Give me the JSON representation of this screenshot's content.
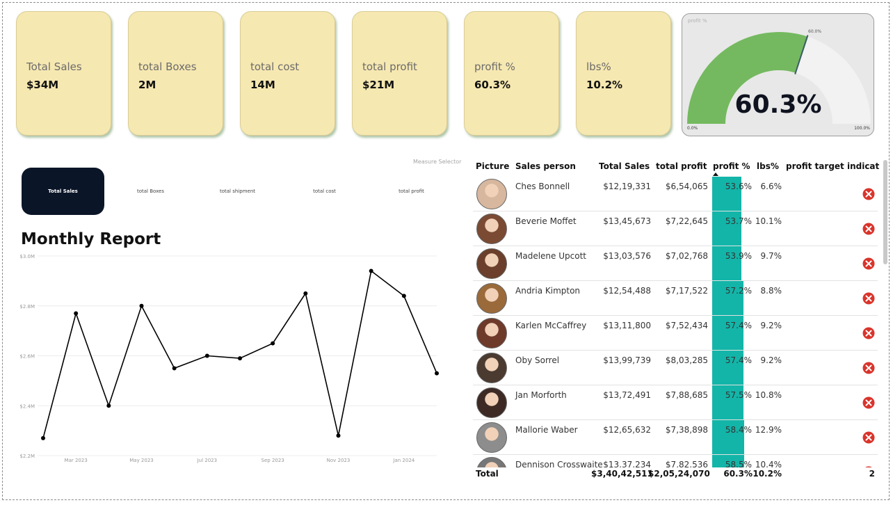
{
  "kpis": [
    {
      "label": "Total Sales",
      "value": "$34M"
    },
    {
      "label": "total Boxes",
      "value": "2M"
    },
    {
      "label": "total cost",
      "value": "14M"
    },
    {
      "label": "total profit",
      "value": "$21M"
    },
    {
      "label": "profit %",
      "value": "60.3%"
    },
    {
      "label": "lbs%",
      "value": "10.2%"
    }
  ],
  "gauge": {
    "title": "profit %",
    "value": 0.603,
    "value_label": "60.3%",
    "marker_label": "60.0%",
    "min_label": "0.0%",
    "max_label": "100.0%",
    "fill_color": "#74b95f",
    "track_color": "#f2f2f2"
  },
  "measure_selector": {
    "title": "Measure Selector",
    "options": [
      "Total Sales",
      "total Boxes",
      "total shipment",
      "total cost",
      "total profit"
    ],
    "selected": "Total Sales"
  },
  "report": {
    "title": "Monthly Report"
  },
  "chart_data": {
    "type": "line",
    "x": [
      "Feb 2023",
      "Mar 2023",
      "Apr 2023",
      "May 2023",
      "Jun 2023",
      "Jul 2023",
      "Aug 2023",
      "Sep 2023",
      "Oct 2023",
      "Nov 2023",
      "Dec 2023",
      "Jan 2024",
      "Feb 2024"
    ],
    "values": [
      2.27,
      2.77,
      2.4,
      2.8,
      2.55,
      2.6,
      2.59,
      2.65,
      2.85,
      2.28,
      2.94,
      2.84,
      2.53
    ],
    "x_tick_labels": [
      "Mar 2023",
      "May 2023",
      "Jul 2023",
      "Sep 2023",
      "Nov 2023",
      "Jan 2024"
    ],
    "y_tick_labels": [
      "$2.2M",
      "$2.4M",
      "$2.6M",
      "$2.8M",
      "$3.0M"
    ],
    "y_ticks": [
      2.2,
      2.4,
      2.6,
      2.8,
      3.0
    ],
    "ylim": [
      2.2,
      3.0
    ],
    "grid": true,
    "color": "#000000"
  },
  "table": {
    "headers": [
      "Picture",
      "Sales person",
      "Total Sales",
      "total profit",
      "profit %",
      "lbs%",
      "profit target indicator"
    ],
    "rows": [
      {
        "name": "Ches Bonnell",
        "sales": "$12,19,331",
        "profit": "$6,54,065",
        "pct": "53.6%",
        "pct_value": 53.6,
        "lbs": "6.6%",
        "avatar_color": "#d7b79e"
      },
      {
        "name": "Beverie Moffet",
        "sales": "$13,45,673",
        "profit": "$7,22,645",
        "pct": "53.7%",
        "pct_value": 53.7,
        "lbs": "10.1%",
        "avatar_color": "#7a4a33"
      },
      {
        "name": "Madelene Upcott",
        "sales": "$13,03,576",
        "profit": "$7,02,768",
        "pct": "53.9%",
        "pct_value": 53.9,
        "lbs": "9.7%",
        "avatar_color": "#6b3f2b"
      },
      {
        "name": "Andria Kimpton",
        "sales": "$12,54,488",
        "profit": "$7,17,522",
        "pct": "57.2%",
        "pct_value": 57.2,
        "lbs": "8.8%",
        "avatar_color": "#9a6a3a"
      },
      {
        "name": "Karlen McCaffrey",
        "sales": "$13,11,800",
        "profit": "$7,52,434",
        "pct": "57.4%",
        "pct_value": 57.4,
        "lbs": "9.2%",
        "avatar_color": "#6e3a2a"
      },
      {
        "name": "Oby Sorrel",
        "sales": "$13,99,739",
        "profit": "$8,03,285",
        "pct": "57.4%",
        "pct_value": 57.4,
        "lbs": "9.2%",
        "avatar_color": "#4a3a30"
      },
      {
        "name": "Jan Morforth",
        "sales": "$13,72,491",
        "profit": "$7,88,685",
        "pct": "57.5%",
        "pct_value": 57.5,
        "lbs": "10.8%",
        "avatar_color": "#3d2a24"
      },
      {
        "name": "Mallorie Waber",
        "sales": "$12,65,632",
        "profit": "$7,38,898",
        "pct": "58.4%",
        "pct_value": 58.4,
        "lbs": "12.9%",
        "avatar_color": "#8d8d8d"
      },
      {
        "name": "Dennison Crosswaite",
        "sales": "$13,37,234",
        "profit": "$7,82,536",
        "pct": "58.5%",
        "pct_value": 58.5,
        "lbs": "10.4%",
        "avatar_color": "#777777"
      }
    ],
    "total": {
      "label": "Total",
      "sales": "$3,40,42,511",
      "profit": "$2,05,24,070",
      "pct": "60.3%",
      "lbs": "10.2%",
      "indicator": "2"
    },
    "bar_color": "#13b5a8",
    "indicator_color": "#d9342b"
  }
}
